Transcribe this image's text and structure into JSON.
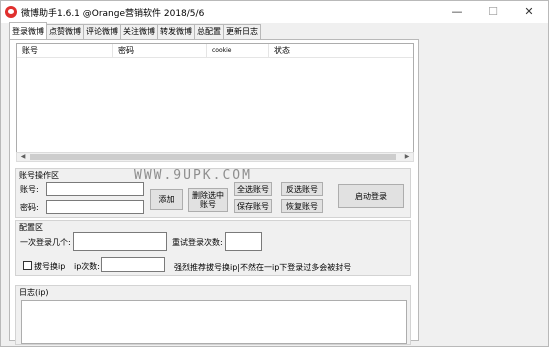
{
  "window": {
    "title": "微博助手1.6.1 @Orange营销软件 2018/5/6",
    "min_glyph": "—",
    "max_glyph": "☐",
    "close_glyph": "✕"
  },
  "tabs": [
    {
      "label": "登录微博"
    },
    {
      "label": "点赞微博"
    },
    {
      "label": "评论微博"
    },
    {
      "label": "关注微博"
    },
    {
      "label": "转发微博"
    },
    {
      "label": "总配置"
    },
    {
      "label": "更新日志"
    }
  ],
  "account_table": {
    "columns": [
      "账号",
      "密码",
      "cookie",
      "状态"
    ],
    "rows": []
  },
  "scrollbar": {
    "left_glyph": "◀",
    "right_glyph": "▶"
  },
  "watermark": "WWW.9UPK.COM",
  "account_ops": {
    "title": "账号操作区",
    "account_label": "账号:",
    "account_value": "",
    "password_label": "密码:",
    "password_value": "",
    "add_button": "添加",
    "delete_selected_button": "删除选中账号",
    "select_all_button": "全选账号",
    "invert_select_button": "反选账号",
    "save_button": "保存账号",
    "restore_button": "恢复账号",
    "start_login_button": "启动登录"
  },
  "config": {
    "title": "配置区",
    "login_count_label": "一次登录几个:",
    "login_count_value": "",
    "retry_label": "重试登录次数:",
    "retry_value": "",
    "dial_label": "拔号换ip",
    "ip_count_label": "ip次数:",
    "ip_count_value": "",
    "note": "强烈推荐拔号换ip|不然在一ip下登录过多会被封号"
  },
  "log": {
    "title": "日志(ip)"
  }
}
